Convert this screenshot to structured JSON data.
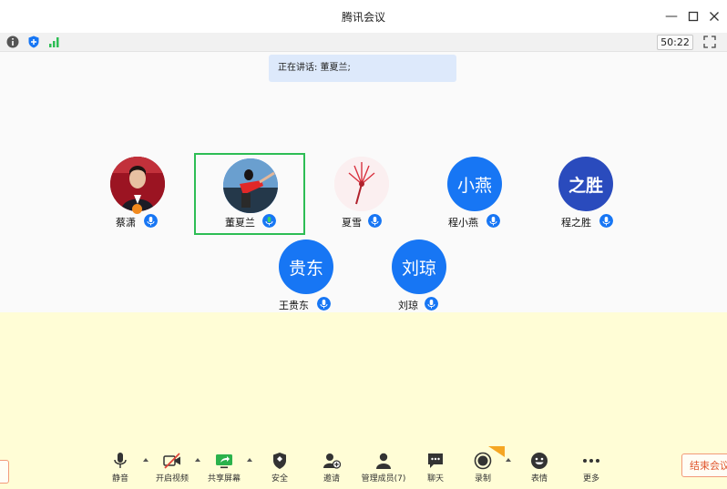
{
  "window": {
    "title": "腾讯会议",
    "controls": [
      "minimize",
      "maximize",
      "close"
    ]
  },
  "statusbar": {
    "icons": [
      "info-icon",
      "shield-icon",
      "signal-icon"
    ],
    "timer": "50:22"
  },
  "speaking": {
    "label": "正在讲话: 董夏兰;"
  },
  "participants": [
    {
      "name": "蔡潇",
      "avatar_type": "photo",
      "mic": "blue",
      "active": false
    },
    {
      "name": "董夏兰",
      "avatar_type": "photo",
      "mic": "green",
      "active": true
    },
    {
      "name": "夏雪",
      "avatar_type": "photo",
      "mic": "blue",
      "active": false
    },
    {
      "name": "程小燕",
      "avatar_type": "text",
      "avatar_text": "小燕",
      "mic": "blue",
      "active": false
    },
    {
      "name": "程之胜",
      "avatar_type": "text",
      "avatar_text": "之胜",
      "mic": "blue",
      "active": false
    },
    {
      "name": "王贵东",
      "avatar_type": "text",
      "avatar_text": "贵东",
      "mic": "blue",
      "active": false
    },
    {
      "name": "刘琼",
      "avatar_type": "text",
      "avatar_text": "刘琼",
      "mic": "blue",
      "active": false
    }
  ],
  "toolbar": {
    "items": [
      {
        "label": "静音",
        "icon": "microphone-icon"
      },
      {
        "label": "开启视频",
        "icon": "video-off-icon"
      },
      {
        "label": "共享屏幕",
        "icon": "share-screen-icon"
      },
      {
        "label": "安全",
        "icon": "security-shield-icon"
      },
      {
        "label": "邀请",
        "icon": "invite-user-icon"
      },
      {
        "label": "管理成员(7)",
        "icon": "members-icon"
      },
      {
        "label": "聊天",
        "icon": "chat-icon"
      },
      {
        "label": "录制",
        "icon": "record-icon"
      },
      {
        "label": "表情",
        "icon": "emoji-icon"
      },
      {
        "label": "更多",
        "icon": "more-icon"
      }
    ],
    "end_label": "结束会议"
  },
  "colors": {
    "accent_blue": "#1776f4",
    "active_green": "#2dbd54",
    "end_red": "#e0562f",
    "lower_bg": "#fffdd6"
  }
}
